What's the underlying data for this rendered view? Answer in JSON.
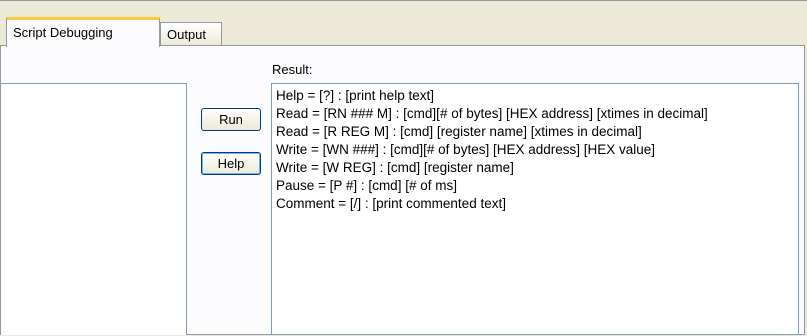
{
  "tabs": [
    {
      "label": "Script Debugging",
      "active": true
    },
    {
      "label": "Output",
      "active": false
    }
  ],
  "result": {
    "label": "Result:",
    "lines": [
      "Help = [?] : [print help text]",
      "Read = [RN ### M] : [cmd][# of bytes] [HEX address] [xtimes in decimal]",
      "Read = [R REG M] : [cmd] [register name] [xtimes in decimal]",
      "Write = [WN ###] : [cmd][# of bytes] [HEX address] [HEX value]",
      "Write = [W REG] : [cmd] [register name]",
      "Pause = [P #] : [cmd] [# of ms]",
      "Comment = [/] : [print commented text]"
    ]
  },
  "buttons": {
    "run_label": "Run",
    "help_label": "Help"
  },
  "colors": {
    "window_bg": "#ece9d8",
    "active_tab_accent": "#ffc83c",
    "border": "#919b9c",
    "textbox_border": "#7f9db9"
  }
}
